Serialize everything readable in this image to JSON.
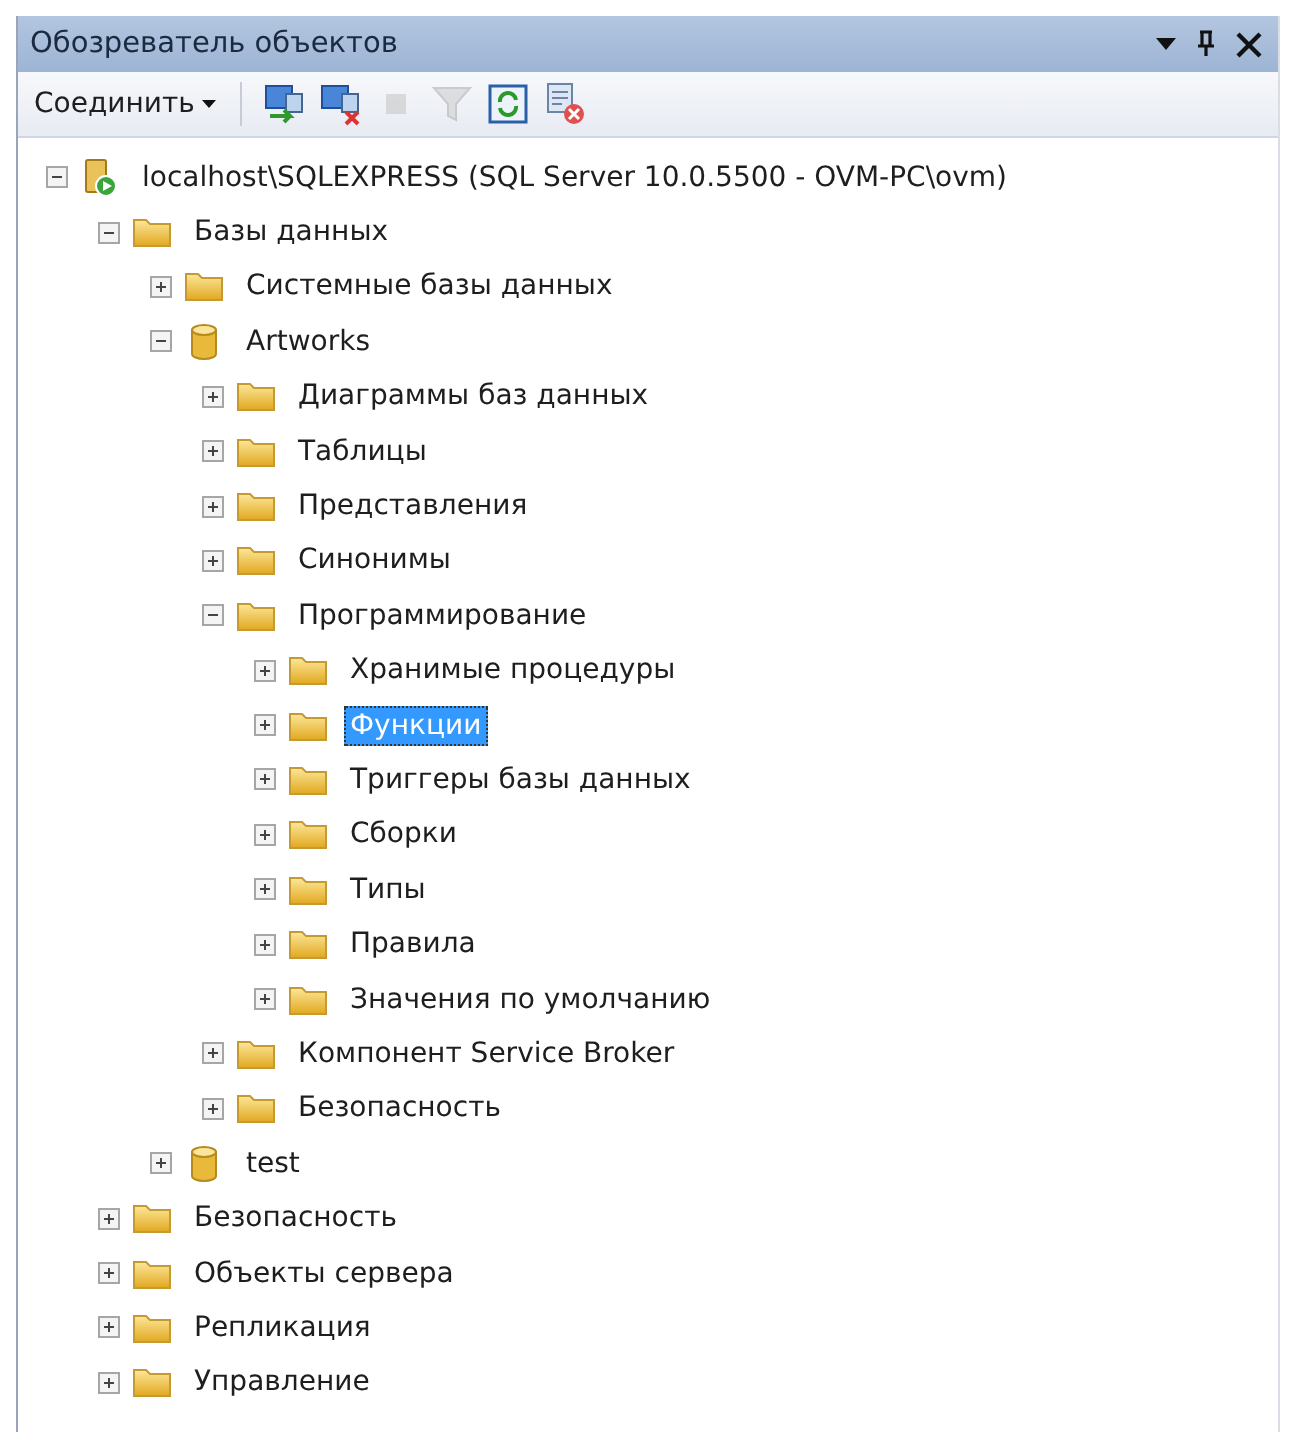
{
  "panel": {
    "title": "Обозреватель объектов"
  },
  "toolbar": {
    "connect_label": "Соединить",
    "tools": [
      {
        "kind": "connect",
        "disabled": false
      },
      {
        "kind": "disconnect",
        "disabled": false
      },
      {
        "kind": "stop",
        "disabled": true
      },
      {
        "kind": "filter",
        "disabled": true
      },
      {
        "kind": "refresh",
        "disabled": false
      },
      {
        "kind": "script",
        "disabled": false
      }
    ]
  },
  "tree": [
    {
      "label": "localhost\\SQLEXPRESS (SQL Server 10.0.5500 - OVM-PC\\ovm)",
      "kind": "server",
      "expanded": true,
      "selected": false,
      "children": [
        {
          "label": "Базы данных",
          "kind": "folder",
          "expanded": true,
          "selected": false,
          "children": [
            {
              "label": "Системные базы данных",
              "kind": "folder",
              "expanded": false,
              "selected": false
            },
            {
              "label": "Artworks",
              "kind": "database",
              "expanded": true,
              "selected": false,
              "children": [
                {
                  "label": "Диаграммы баз данных",
                  "kind": "folder",
                  "expanded": false,
                  "selected": false
                },
                {
                  "label": "Таблицы",
                  "kind": "folder",
                  "expanded": false,
                  "selected": false
                },
                {
                  "label": "Представления",
                  "kind": "folder",
                  "expanded": false,
                  "selected": false
                },
                {
                  "label": "Синонимы",
                  "kind": "folder",
                  "expanded": false,
                  "selected": false
                },
                {
                  "label": "Программирование",
                  "kind": "folder",
                  "expanded": true,
                  "selected": false,
                  "children": [
                    {
                      "label": "Хранимые процедуры",
                      "kind": "folder",
                      "expanded": false,
                      "selected": false
                    },
                    {
                      "label": "Функции",
                      "kind": "folder",
                      "expanded": false,
                      "selected": true
                    },
                    {
                      "label": "Триггеры базы данных",
                      "kind": "folder",
                      "expanded": false,
                      "selected": false
                    },
                    {
                      "label": "Сборки",
                      "kind": "folder",
                      "expanded": false,
                      "selected": false
                    },
                    {
                      "label": "Типы",
                      "kind": "folder",
                      "expanded": false,
                      "selected": false
                    },
                    {
                      "label": "Правила",
                      "kind": "folder",
                      "expanded": false,
                      "selected": false
                    },
                    {
                      "label": "Значения по умолчанию",
                      "kind": "folder",
                      "expanded": false,
                      "selected": false
                    }
                  ]
                },
                {
                  "label": "Компонент Service Broker",
                  "kind": "folder",
                  "expanded": false,
                  "selected": false
                },
                {
                  "label": "Безопасность",
                  "kind": "folder",
                  "expanded": false,
                  "selected": false
                }
              ]
            },
            {
              "label": "test",
              "kind": "database",
              "expanded": false,
              "selected": false
            }
          ]
        },
        {
          "label": "Безопасность",
          "kind": "folder",
          "expanded": false,
          "selected": false
        },
        {
          "label": "Объекты сервера",
          "kind": "folder",
          "expanded": false,
          "selected": false
        },
        {
          "label": "Репликация",
          "kind": "folder",
          "expanded": false,
          "selected": false
        },
        {
          "label": "Управление",
          "kind": "folder",
          "expanded": false,
          "selected": false
        }
      ]
    }
  ]
}
